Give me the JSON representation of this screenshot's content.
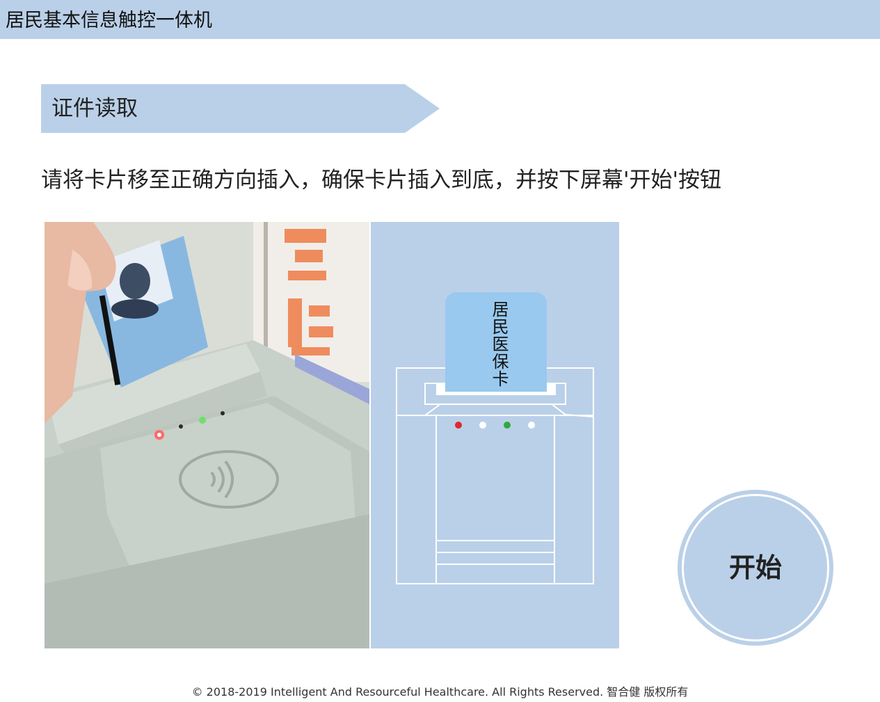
{
  "header": {
    "title": "居民基本信息触控一体机"
  },
  "section": {
    "title": "证件读取"
  },
  "instruction": "请将卡片移至正确方向插入，确保卡片插入到底，并按下屏幕'开始'按钮",
  "diagram": {
    "card_label": "居民医保卡",
    "indicator_colors": [
      "#e0282e",
      "#ffffff",
      "#2eaa3c",
      "#ffffff"
    ]
  },
  "actions": {
    "start_label": "开始"
  },
  "footer": {
    "copyright": "© 2018-2019 Intelligent And Resourceful Healthcare. All Rights Reserved. 智合健 版权所有"
  },
  "colors": {
    "banner": "#bad0e8",
    "diagram_bg": "#bad0e8",
    "card": "#99c9ee"
  }
}
